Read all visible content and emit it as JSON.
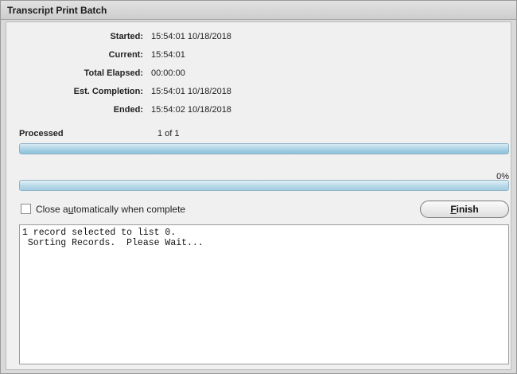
{
  "window": {
    "title": "Transcript Print Batch"
  },
  "info": [
    {
      "label": "Started:",
      "value": "15:54:01  10/18/2018"
    },
    {
      "label": "Current:",
      "value": "15:54:01"
    },
    {
      "label": "Total Elapsed:",
      "value": "00:00:00"
    },
    {
      "label": "Est. Completion:",
      "value": "15:54:01  10/18/2018"
    },
    {
      "label": "Ended:",
      "value": "15:54:02  10/18/2018"
    }
  ],
  "processed": {
    "label": "Processed",
    "value": "1  of  1",
    "progress_fraction": 1.0
  },
  "overall": {
    "percent_text": "0%",
    "progress_fraction": 0.0
  },
  "close_checkbox": {
    "label_pre": "Close a",
    "label_underline": "u",
    "label_post": "tomatically when complete",
    "checked": false
  },
  "finish_button": {
    "label_underline": "F",
    "label_post": "inish"
  },
  "log": {
    "lines": [
      "1 record selected to list 0.",
      " Sorting Records.  Please Wait..."
    ]
  },
  "colors": {
    "progress_fill": "#a9d1e4",
    "window_bg": "#d9d9d9"
  }
}
